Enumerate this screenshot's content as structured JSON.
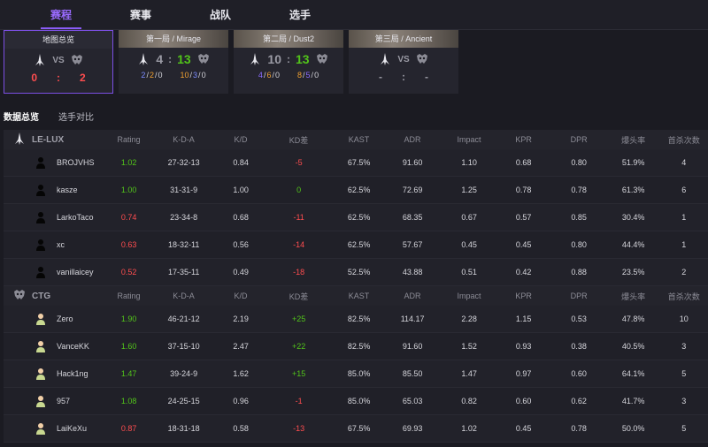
{
  "nav": {
    "tabs": [
      {
        "label": "赛程",
        "active": true
      },
      {
        "label": "赛事",
        "active": false
      },
      {
        "label": "战队",
        "active": false
      },
      {
        "label": "选手",
        "active": false
      }
    ]
  },
  "maps": {
    "overview": {
      "title": "地图总览",
      "score_left": "0",
      "score_right": "2",
      "vs": "VS"
    },
    "map1": {
      "title": "第一局 / Mirage",
      "score_left": "4",
      "score_right": "13",
      "colon": ":",
      "left_kda": [
        "2",
        "2",
        "0"
      ],
      "right_kda": [
        "10",
        "3",
        "0"
      ]
    },
    "map2": {
      "title": "第二局 / Dust2",
      "score_left": "10",
      "score_right": "13",
      "colon": ":",
      "left_kda": [
        "4",
        "6",
        "0"
      ],
      "right_kda": [
        "8",
        "5",
        "0"
      ]
    },
    "map3": {
      "title": "第三局 / Ancient",
      "vs": "VS",
      "score_left": "-",
      "score_right": "-"
    }
  },
  "subtabs": {
    "overview": "数据总览",
    "compare": "选手对比"
  },
  "columns": [
    "Rating",
    "K-D-A",
    "K/D",
    "KD差",
    "KAST",
    "ADR",
    "Impact",
    "KPR",
    "DPR",
    "爆头率",
    "首杀次数"
  ],
  "teams": [
    {
      "name": "LE-LUX",
      "players": [
        {
          "name": "BROJVHS",
          "rating": "1.02",
          "rating_color": "pos",
          "kda": "27-32-13",
          "kd": "0.84",
          "diff": "-5",
          "diff_color": "neg",
          "kast": "67.5%",
          "adr": "91.60",
          "impact": "1.10",
          "kpr": "0.68",
          "dpr": "0.80",
          "hs": "51.9%",
          "fk": "4"
        },
        {
          "name": "kasze",
          "rating": "1.00",
          "rating_color": "pos",
          "kda": "31-31-9",
          "kd": "1.00",
          "diff": "0",
          "diff_color": "zero",
          "kast": "62.5%",
          "adr": "72.69",
          "impact": "1.25",
          "kpr": "0.78",
          "dpr": "0.78",
          "hs": "61.3%",
          "fk": "6"
        },
        {
          "name": "LarkoTaco",
          "rating": "0.74",
          "rating_color": "neg",
          "kda": "23-34-8",
          "kd": "0.68",
          "diff": "-11",
          "diff_color": "neg",
          "kast": "62.5%",
          "adr": "68.35",
          "impact": "0.67",
          "kpr": "0.57",
          "dpr": "0.85",
          "hs": "30.4%",
          "fk": "1"
        },
        {
          "name": "xc",
          "rating": "0.63",
          "rating_color": "neg",
          "kda": "18-32-11",
          "kd": "0.56",
          "diff": "-14",
          "diff_color": "neg",
          "kast": "62.5%",
          "adr": "57.67",
          "impact": "0.45",
          "kpr": "0.45",
          "dpr": "0.80",
          "hs": "44.4%",
          "fk": "1"
        },
        {
          "name": "vanillaicey",
          "rating": "0.52",
          "rating_color": "neg",
          "kda": "17-35-11",
          "kd": "0.49",
          "diff": "-18",
          "diff_color": "neg",
          "kast": "52.5%",
          "adr": "43.88",
          "impact": "0.51",
          "kpr": "0.42",
          "dpr": "0.88",
          "hs": "23.5%",
          "fk": "2"
        }
      ]
    },
    {
      "name": "CTG",
      "players": [
        {
          "name": "Zero",
          "rating": "1.90",
          "rating_color": "pos",
          "kda": "46-21-12",
          "kd": "2.19",
          "diff": "+25",
          "diff_color": "pos",
          "kast": "82.5%",
          "adr": "114.17",
          "impact": "2.28",
          "kpr": "1.15",
          "dpr": "0.53",
          "hs": "47.8%",
          "fk": "10"
        },
        {
          "name": "VanceKK",
          "rating": "1.60",
          "rating_color": "pos",
          "kda": "37-15-10",
          "kd": "2.47",
          "diff": "+22",
          "diff_color": "pos",
          "kast": "82.5%",
          "adr": "91.60",
          "impact": "1.52",
          "kpr": "0.93",
          "dpr": "0.38",
          "hs": "40.5%",
          "fk": "3"
        },
        {
          "name": "Hack1ng",
          "rating": "1.47",
          "rating_color": "pos",
          "kda": "39-24-9",
          "kd": "1.62",
          "diff": "+15",
          "diff_color": "pos",
          "kast": "85.0%",
          "adr": "85.50",
          "impact": "1.47",
          "kpr": "0.97",
          "dpr": "0.60",
          "hs": "64.1%",
          "fk": "5"
        },
        {
          "name": "957",
          "rating": "1.08",
          "rating_color": "pos",
          "kda": "24-25-15",
          "kd": "0.96",
          "diff": "-1",
          "diff_color": "neg",
          "kast": "85.0%",
          "adr": "65.03",
          "impact": "0.82",
          "kpr": "0.60",
          "dpr": "0.62",
          "hs": "41.7%",
          "fk": "3"
        },
        {
          "name": "LaiKeXu",
          "rating": "0.87",
          "rating_color": "neg",
          "kda": "18-31-18",
          "kd": "0.58",
          "diff": "-13",
          "diff_color": "neg",
          "kast": "67.5%",
          "adr": "69.93",
          "impact": "1.02",
          "kpr": "0.45",
          "dpr": "0.78",
          "hs": "50.0%",
          "fk": "5"
        }
      ]
    }
  ],
  "colors": {
    "accent": "#8a5cf6",
    "positive": "#52c41a",
    "negative": "#ff4d4f",
    "blue": "#7b8cff",
    "orange": "#f0a030"
  }
}
